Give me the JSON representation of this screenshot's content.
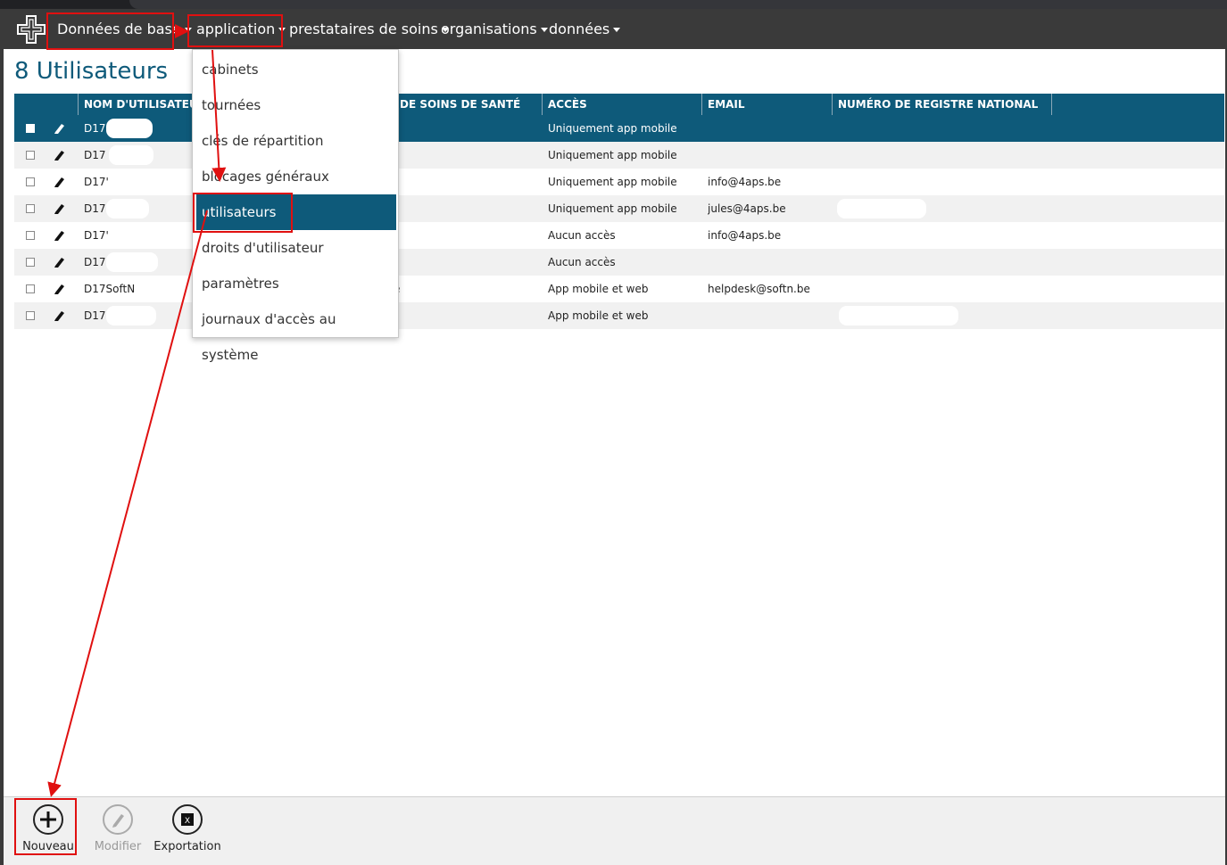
{
  "nav": {
    "items": [
      {
        "label": "Données de base"
      },
      {
        "label": "application"
      },
      {
        "label": "prestataires de soins"
      },
      {
        "label": "organisations"
      },
      {
        "label": "données"
      }
    ]
  },
  "page": {
    "title": "8 Utilisateurs"
  },
  "grid": {
    "columns": [
      "NOM D'UTILISATEUR",
      "DE SOINS DE SANTÉ",
      "ACCÈS",
      "EMAIL",
      "NUMÉRO DE REGISTRE NATIONAL"
    ],
    "rows": [
      {
        "user": "D17",
        "care": "",
        "access": "Uniquement app mobile",
        "email": "",
        "rn": ""
      },
      {
        "user": "D17",
        "care": "",
        "access": "Uniquement app mobile",
        "email": "",
        "rn": ""
      },
      {
        "user": "D17'",
        "care": "",
        "access": "Uniquement app mobile",
        "email": "info@4aps.be",
        "rn": ""
      },
      {
        "user": "D17",
        "care": "",
        "access": "Uniquement app mobile",
        "email": "jules@4aps.be",
        "rn": ""
      },
      {
        "user": "D17'",
        "care": "",
        "access": "Aucun accès",
        "email": "info@4aps.be",
        "rn": ""
      },
      {
        "user": "D17",
        "care": "",
        "access": "Aucun accès",
        "email": "",
        "rn": ""
      },
      {
        "user": "D17SoftN",
        "care": "e",
        "access": "App mobile et web",
        "email": "helpdesk@softn.be",
        "rn": ""
      },
      {
        "user": "D17",
        "care": "",
        "access": "App mobile et web",
        "email": "",
        "rn": "!"
      }
    ]
  },
  "dropdown": {
    "items": [
      {
        "label": "cabinets"
      },
      {
        "label": "tournées"
      },
      {
        "label": "clés de répartition"
      },
      {
        "label": "blocages généraux"
      },
      {
        "label": "utilisateurs"
      },
      {
        "label": "droits d'utilisateur"
      },
      {
        "label": "paramètres"
      },
      {
        "label": "journaux d'accès au système"
      }
    ]
  },
  "toolbar": {
    "new_label": "Nouveau",
    "edit_label": "Modifier",
    "export_label": "Exportation"
  },
  "colors": {
    "accent": "#0e5a7a",
    "topbar": "#3a3a3a",
    "annotation": "#e01010"
  },
  "icons": [
    "logo-cross-icon",
    "caret-down-icon",
    "pencil-icon",
    "plus-circle-icon",
    "excel-icon"
  ]
}
